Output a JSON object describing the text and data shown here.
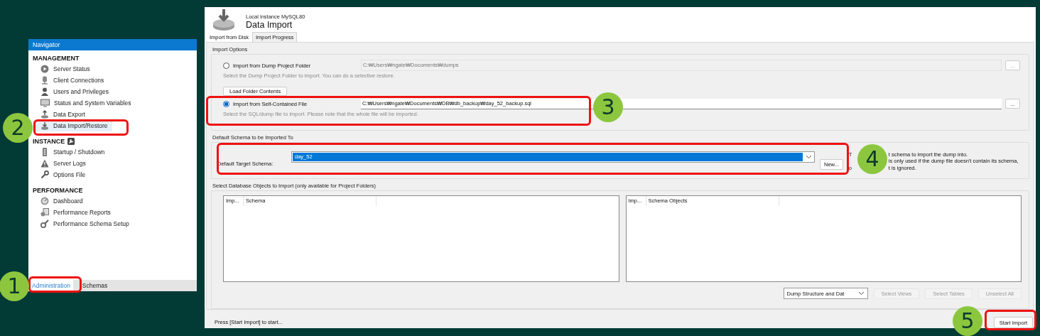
{
  "navigator": {
    "title": "Navigator",
    "sections": [
      {
        "title": "MANAGEMENT",
        "items": [
          {
            "label": "Server Status",
            "selected": false
          },
          {
            "label": "Client Connections",
            "selected": false
          },
          {
            "label": "Users and Privileges",
            "selected": false
          },
          {
            "label": "Status and System Variables",
            "selected": false
          },
          {
            "label": "Data Export",
            "selected": false
          },
          {
            "label": "Data Import/Restore",
            "selected": true
          }
        ]
      },
      {
        "title": "INSTANCE",
        "items": [
          {
            "label": "Startup / Shutdown",
            "selected": false
          },
          {
            "label": "Server Logs",
            "selected": false
          },
          {
            "label": "Options File",
            "selected": false
          }
        ]
      },
      {
        "title": "PERFORMANCE",
        "items": [
          {
            "label": "Dashboard",
            "selected": false
          },
          {
            "label": "Performance Reports",
            "selected": false
          },
          {
            "label": "Performance Schema Setup",
            "selected": false
          }
        ]
      }
    ],
    "tabs": [
      {
        "label": "Administration",
        "selected": true
      },
      {
        "label": "Schemas",
        "selected": false
      }
    ]
  },
  "header": {
    "subtitle": "Local instance MySQL80",
    "title": "Data Import"
  },
  "tabs": [
    {
      "label": "Import from Disk",
      "selected": true
    },
    {
      "label": "Import Progress",
      "selected": false
    }
  ],
  "import_options": {
    "title": "Import Options",
    "options": [
      {
        "label": "Import from Dump Project Folder",
        "selected": false,
        "path": "C:₩Users₩ngate₩Documents₩dumps",
        "browse": "...",
        "hint": "Select the Dump Project Folder to import. You can do a selective restore.",
        "button": "Load Folder Contents"
      },
      {
        "label": "Import from Self-Contained File",
        "selected": true,
        "path": "C:₩Users₩ngate₩Documents₩DB₩db_backup₩day_52_backup.sql",
        "browse": "...",
        "hint": "Select the SQL/dump file to import. Please note that the whole file will be imported."
      }
    ]
  },
  "schema": {
    "title": "Default Schema to be Imported To",
    "label": "Default Target Schema:",
    "value": "day_52",
    "new_button": "New...",
    "note_lines": [
      {
        "before": "T",
        "after": "t schema to import the dump into."
      },
      {
        "after": "is only used if the dump file doesn't contain its schema,"
      },
      {
        "before": "o",
        "after": "t is ignored."
      }
    ]
  },
  "objects": {
    "title": "Select Database Objects to Import (only available for Project Folders)",
    "lists": [
      {
        "columns": [
          "Imp...",
          "Schema"
        ]
      },
      {
        "columns": [
          "Imp...",
          "Schema Objects"
        ]
      }
    ],
    "dump_mode": "Dump Structure and Dat",
    "buttons": [
      {
        "label": "Select Views",
        "disabled": true
      },
      {
        "label": "Select Tables",
        "disabled": true
      },
      {
        "label": "Unselect All",
        "disabled": true
      }
    ]
  },
  "status": "Press [Start Import] to start...",
  "start_button": "Start Import",
  "callouts": [
    {
      "number": "1"
    },
    {
      "number": "2"
    },
    {
      "number": "3"
    },
    {
      "number": "4"
    },
    {
      "number": "5"
    }
  ]
}
